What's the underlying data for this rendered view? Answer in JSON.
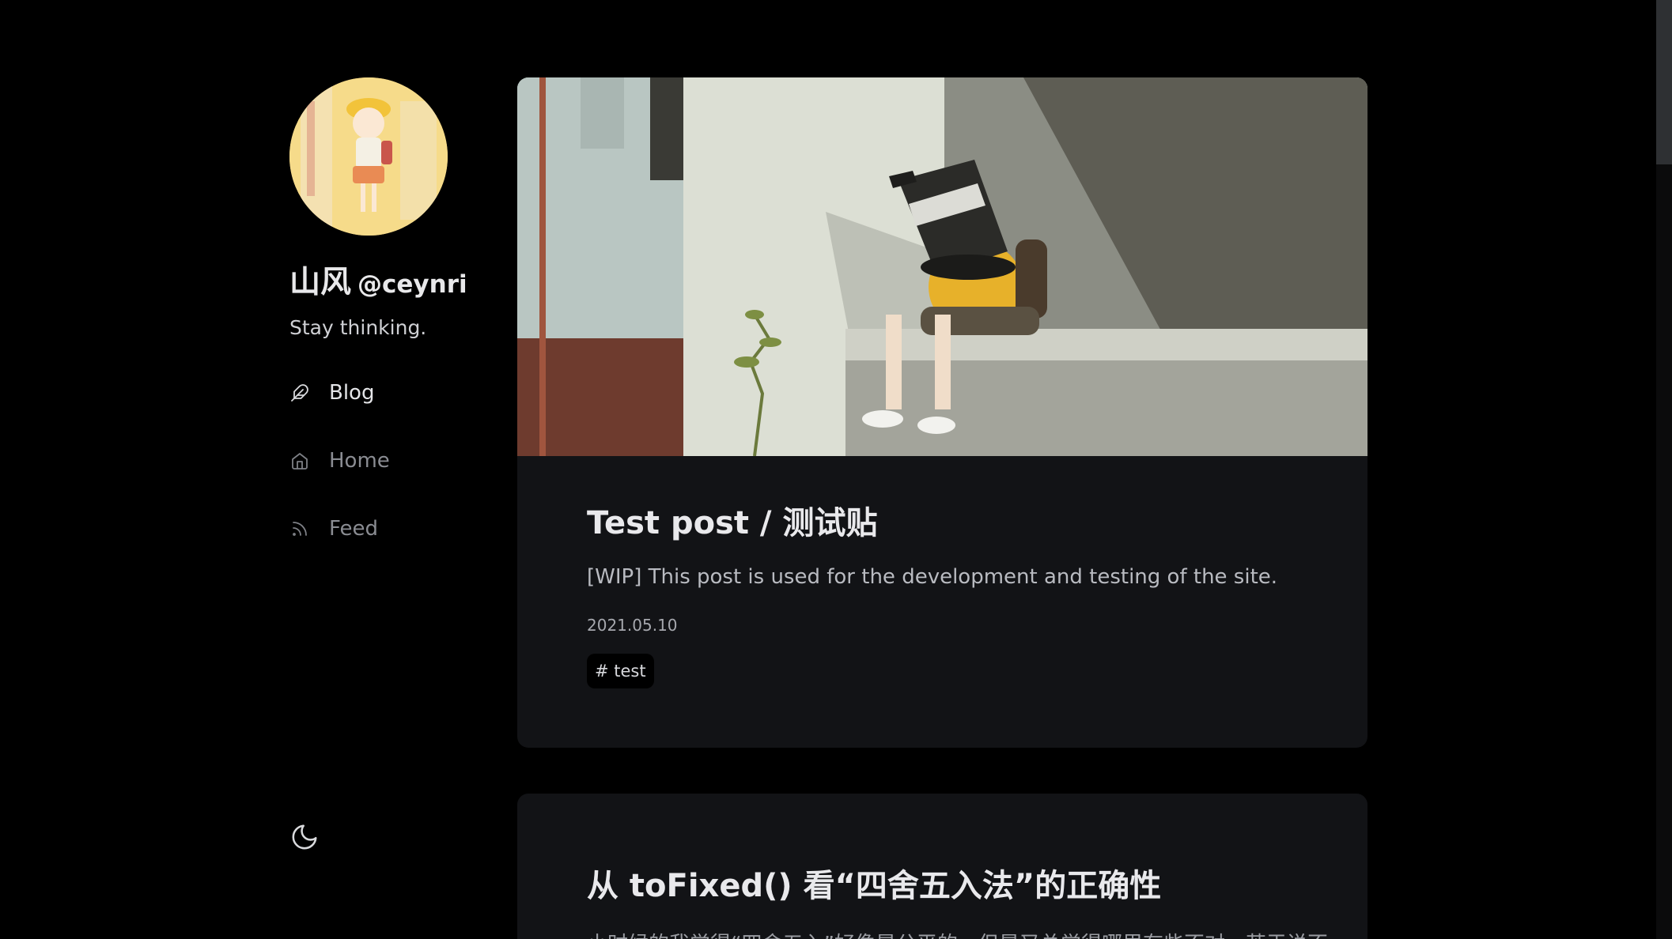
{
  "sidebar": {
    "author_name": "山风",
    "author_handle": "@ceynri",
    "tagline": "Stay thinking.",
    "nav": [
      {
        "label": "Blog",
        "icon": "feather-icon",
        "active": true
      },
      {
        "label": "Home",
        "icon": "home-icon",
        "active": false
      },
      {
        "label": "Feed",
        "icon": "rss-icon",
        "active": false
      }
    ],
    "theme_toggle_icon": "moon-icon"
  },
  "posts": [
    {
      "title": "Test post / 测试贴",
      "excerpt": "[WIP] This post is used for the development and testing of the site.",
      "date": "2021.05.10",
      "tags": [
        "# test"
      ]
    },
    {
      "title": "从 toFixed() 看“四舍五入法”的正确性",
      "excerpt": "小时候的我觉得“四舍五入”好像是公平的，但是又总觉得哪里有些不对，苦于说不"
    }
  ],
  "colors": {
    "background": "#000000",
    "card": "#121316",
    "text_primary": "#e9e9ec",
    "text_muted": "#8a8c92"
  }
}
